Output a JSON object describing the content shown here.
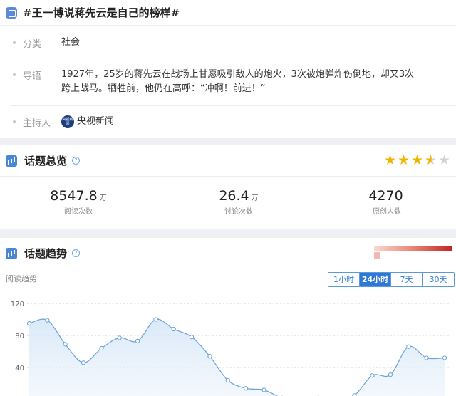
{
  "topic": {
    "title": "#王一博说蒋先云是自己的榜样#",
    "category_label": "分类",
    "category_value": "社会",
    "lead_label": "导语",
    "lead_line1": "1927年，25岁的蒋先云在战场上甘愿吸引敌人的炮火，3次被炮弹炸伤倒地，却又3次",
    "lead_line2": "跨上战马。牺牲前，他仍在高呼：“冲啊！前进！”",
    "host_label": "主持人",
    "host_logo_text": "央视新闻",
    "host_name": "央视新闻"
  },
  "overview": {
    "title": "话题总览",
    "rating": 3.5,
    "stars": [
      "★",
      "★",
      "★",
      "★",
      "★"
    ],
    "stats": [
      {
        "value": "8547.8",
        "unit": "万",
        "caption": "阅读次数"
      },
      {
        "value": "26.4",
        "unit": "万",
        "caption": "讨论次数"
      },
      {
        "value": "4270",
        "unit": "",
        "caption": "原创人数"
      }
    ]
  },
  "trend": {
    "title": "话题趋势",
    "subtitle": "阅读趋势",
    "tabs": [
      "1小时",
      "24小时",
      "7天",
      "30天"
    ],
    "active_tab": "24小时",
    "accent": "#2f78d6",
    "line_color": "#6aa2dc",
    "heat_colors": [
      "#f8d8d2",
      "#c02424"
    ]
  },
  "chart_data": {
    "type": "area",
    "title": "",
    "xlabel": "",
    "ylabel": "",
    "ylim": [
      0,
      120
    ],
    "yticks": [
      40,
      80,
      120
    ],
    "grid": true,
    "x": [
      0,
      1,
      2,
      3,
      4,
      5,
      6,
      7,
      8,
      9,
      10,
      11,
      12,
      13,
      14,
      15,
      16,
      17,
      18,
      19,
      20,
      21,
      22,
      23
    ],
    "series": [
      {
        "values": [
          95,
          99,
          69,
          46,
          64,
          77,
          73,
          100,
          88,
          78,
          54,
          24,
          14,
          12,
          2,
          0,
          2,
          0,
          5,
          30,
          31,
          66,
          52,
          52
        ]
      }
    ]
  }
}
